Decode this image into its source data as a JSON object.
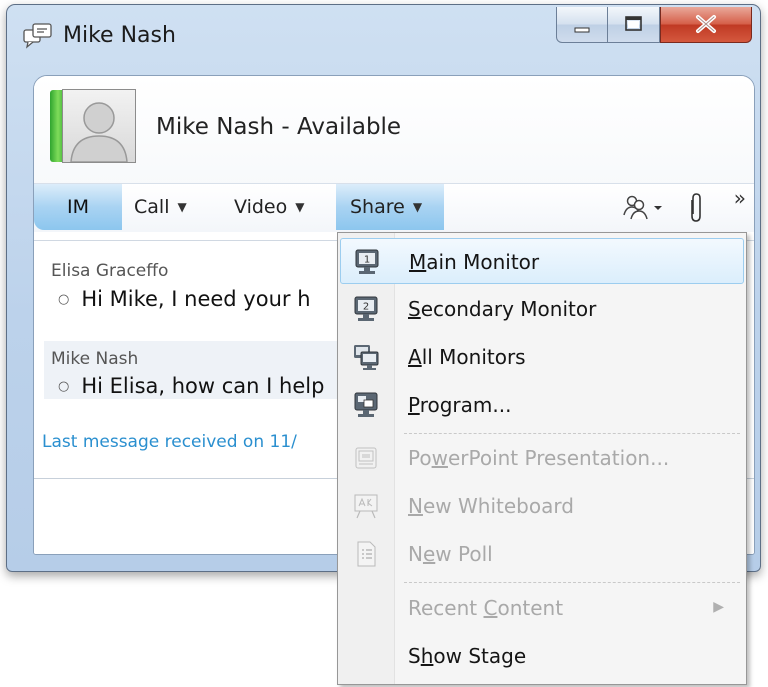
{
  "window": {
    "title": "Mike Nash",
    "controls": {
      "minimize": "minimize",
      "maximize": "maximize",
      "close": "close"
    }
  },
  "contact": {
    "name_status": "Mike Nash - Available",
    "presence_color": "#3cb33c"
  },
  "toolbar": {
    "im_label": "IM",
    "call_label": "Call",
    "video_label": "Video",
    "share_label": "Share",
    "icons": [
      "people-options-icon",
      "attachment-icon",
      "more-chevron-icon"
    ],
    "more_glyph": "»"
  },
  "conversation": {
    "messages": [
      {
        "sender": "Elisa Graceffo",
        "text": "Hi Mike, I need your h"
      },
      {
        "sender": "Mike Nash",
        "text": "Hi Elisa, how can I help"
      }
    ],
    "last_received": "Last message received on 11/"
  },
  "share_menu": {
    "items": [
      {
        "pre": "",
        "u": "M",
        "post": "ain Monitor",
        "icon": "monitor-1-icon",
        "enabled": true,
        "hovered": true
      },
      {
        "pre": "",
        "u": "S",
        "post": "econdary Monitor",
        "icon": "monitor-2-icon",
        "enabled": true
      },
      {
        "pre": "",
        "u": "A",
        "post": "ll Monitors",
        "icon": "all-monitors-icon",
        "enabled": true
      },
      {
        "pre": "",
        "u": "P",
        "post": "rogram...",
        "icon": "program-icon",
        "enabled": true
      },
      {
        "pre": "Po",
        "u": "w",
        "post": "erPoint Presentation...",
        "icon": "powerpoint-icon",
        "enabled": false
      },
      {
        "pre": "",
        "u": "N",
        "post": "ew Whiteboard",
        "icon": "whiteboard-icon",
        "enabled": false
      },
      {
        "pre": "N",
        "u": "e",
        "post": "w Poll",
        "icon": "poll-icon",
        "enabled": false
      },
      {
        "pre": "Recent ",
        "u": "C",
        "post": "ontent",
        "icon": "",
        "enabled": false,
        "submenu": true
      },
      {
        "pre": "S",
        "u": "h",
        "post": "ow Stage",
        "icon": "",
        "enabled": true
      }
    ],
    "submenu_arrow": "▶"
  }
}
